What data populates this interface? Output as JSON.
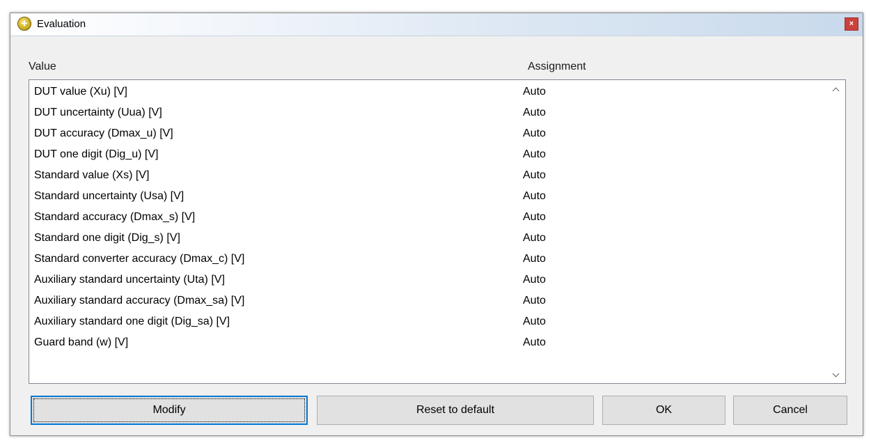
{
  "window": {
    "title": "Evaluation",
    "icon": "plus-circle-icon",
    "close_symbol": "×"
  },
  "columns": {
    "value": "Value",
    "assignment": "Assignment"
  },
  "rows": [
    {
      "value": "DUT value (Xu) [V]",
      "assignment": "Auto"
    },
    {
      "value": "DUT uncertainty (Uua) [V]",
      "assignment": "Auto"
    },
    {
      "value": "DUT accuracy (Dmax_u) [V]",
      "assignment": "Auto"
    },
    {
      "value": "DUT one digit (Dig_u) [V]",
      "assignment": "Auto"
    },
    {
      "value": "Standard value (Xs) [V]",
      "assignment": "Auto"
    },
    {
      "value": "Standard uncertainty (Usa) [V]",
      "assignment": "Auto"
    },
    {
      "value": "Standard accuracy (Dmax_s) [V]",
      "assignment": "Auto"
    },
    {
      "value": "Standard one digit (Dig_s) [V]",
      "assignment": "Auto"
    },
    {
      "value": "Standard converter accuracy (Dmax_c) [V]",
      "assignment": "Auto"
    },
    {
      "value": "Auxiliary standard uncertainty (Uta) [V]",
      "assignment": "Auto"
    },
    {
      "value": "Auxiliary standard accuracy (Dmax_sa) [V]",
      "assignment": "Auto"
    },
    {
      "value": "Auxiliary standard one digit (Dig_sa) [V]",
      "assignment": "Auto"
    },
    {
      "value": "Guard band (w) [V]",
      "assignment": "Auto"
    }
  ],
  "buttons": {
    "modify": "Modify",
    "reset": "Reset to default",
    "ok": "OK",
    "cancel": "Cancel"
  },
  "colors": {
    "focus_border": "#0078d7",
    "close_button": "#c9423c"
  }
}
